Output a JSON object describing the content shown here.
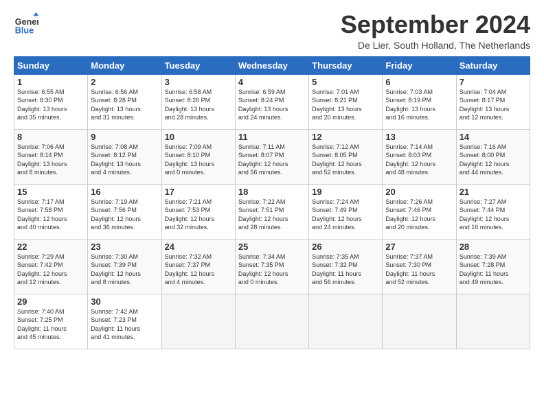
{
  "logo": {
    "text_general": "General",
    "text_blue": "Blue"
  },
  "title": "September 2024",
  "subtitle": "De Lier, South Holland, The Netherlands",
  "days_of_week": [
    "Sunday",
    "Monday",
    "Tuesday",
    "Wednesday",
    "Thursday",
    "Friday",
    "Saturday"
  ],
  "weeks": [
    [
      {
        "num": "1",
        "info": "Sunrise: 6:55 AM\nSunset: 8:30 PM\nDaylight: 13 hours\nand 35 minutes."
      },
      {
        "num": "2",
        "info": "Sunrise: 6:56 AM\nSunset: 8:28 PM\nDaylight: 13 hours\nand 31 minutes."
      },
      {
        "num": "3",
        "info": "Sunrise: 6:58 AM\nSunset: 8:26 PM\nDaylight: 13 hours\nand 28 minutes."
      },
      {
        "num": "4",
        "info": "Sunrise: 6:59 AM\nSunset: 8:24 PM\nDaylight: 13 hours\nand 24 minutes."
      },
      {
        "num": "5",
        "info": "Sunrise: 7:01 AM\nSunset: 8:21 PM\nDaylight: 13 hours\nand 20 minutes."
      },
      {
        "num": "6",
        "info": "Sunrise: 7:03 AM\nSunset: 8:19 PM\nDaylight: 13 hours\nand 16 minutes."
      },
      {
        "num": "7",
        "info": "Sunrise: 7:04 AM\nSunset: 8:17 PM\nDaylight: 13 hours\nand 12 minutes."
      }
    ],
    [
      {
        "num": "8",
        "info": "Sunrise: 7:06 AM\nSunset: 8:14 PM\nDaylight: 13 hours\nand 8 minutes."
      },
      {
        "num": "9",
        "info": "Sunrise: 7:08 AM\nSunset: 8:12 PM\nDaylight: 13 hours\nand 4 minutes."
      },
      {
        "num": "10",
        "info": "Sunrise: 7:09 AM\nSunset: 8:10 PM\nDaylight: 13 hours\nand 0 minutes."
      },
      {
        "num": "11",
        "info": "Sunrise: 7:11 AM\nSunset: 8:07 PM\nDaylight: 12 hours\nand 56 minutes."
      },
      {
        "num": "12",
        "info": "Sunrise: 7:12 AM\nSunset: 8:05 PM\nDaylight: 12 hours\nand 52 minutes."
      },
      {
        "num": "13",
        "info": "Sunrise: 7:14 AM\nSunset: 8:03 PM\nDaylight: 12 hours\nand 48 minutes."
      },
      {
        "num": "14",
        "info": "Sunrise: 7:16 AM\nSunset: 8:00 PM\nDaylight: 12 hours\nand 44 minutes."
      }
    ],
    [
      {
        "num": "15",
        "info": "Sunrise: 7:17 AM\nSunset: 7:58 PM\nDaylight: 12 hours\nand 40 minutes."
      },
      {
        "num": "16",
        "info": "Sunrise: 7:19 AM\nSunset: 7:56 PM\nDaylight: 12 hours\nand 36 minutes."
      },
      {
        "num": "17",
        "info": "Sunrise: 7:21 AM\nSunset: 7:53 PM\nDaylight: 12 hours\nand 32 minutes."
      },
      {
        "num": "18",
        "info": "Sunrise: 7:22 AM\nSunset: 7:51 PM\nDaylight: 12 hours\nand 28 minutes."
      },
      {
        "num": "19",
        "info": "Sunrise: 7:24 AM\nSunset: 7:49 PM\nDaylight: 12 hours\nand 24 minutes."
      },
      {
        "num": "20",
        "info": "Sunrise: 7:26 AM\nSunset: 7:46 PM\nDaylight: 12 hours\nand 20 minutes."
      },
      {
        "num": "21",
        "info": "Sunrise: 7:27 AM\nSunset: 7:44 PM\nDaylight: 12 hours\nand 16 minutes."
      }
    ],
    [
      {
        "num": "22",
        "info": "Sunrise: 7:29 AM\nSunset: 7:42 PM\nDaylight: 12 hours\nand 12 minutes."
      },
      {
        "num": "23",
        "info": "Sunrise: 7:30 AM\nSunset: 7:39 PM\nDaylight: 12 hours\nand 8 minutes."
      },
      {
        "num": "24",
        "info": "Sunrise: 7:32 AM\nSunset: 7:37 PM\nDaylight: 12 hours\nand 4 minutes."
      },
      {
        "num": "25",
        "info": "Sunrise: 7:34 AM\nSunset: 7:35 PM\nDaylight: 12 hours\nand 0 minutes."
      },
      {
        "num": "26",
        "info": "Sunrise: 7:35 AM\nSunset: 7:32 PM\nDaylight: 11 hours\nand 56 minutes."
      },
      {
        "num": "27",
        "info": "Sunrise: 7:37 AM\nSunset: 7:30 PM\nDaylight: 11 hours\nand 52 minutes."
      },
      {
        "num": "28",
        "info": "Sunrise: 7:39 AM\nSunset: 7:28 PM\nDaylight: 11 hours\nand 49 minutes."
      }
    ],
    [
      {
        "num": "29",
        "info": "Sunrise: 7:40 AM\nSunset: 7:25 PM\nDaylight: 11 hours\nand 45 minutes."
      },
      {
        "num": "30",
        "info": "Sunrise: 7:42 AM\nSunset: 7:23 PM\nDaylight: 11 hours\nand 41 minutes."
      },
      {
        "num": "",
        "info": "",
        "empty": true
      },
      {
        "num": "",
        "info": "",
        "empty": true
      },
      {
        "num": "",
        "info": "",
        "empty": true
      },
      {
        "num": "",
        "info": "",
        "empty": true
      },
      {
        "num": "",
        "info": "",
        "empty": true
      }
    ]
  ]
}
